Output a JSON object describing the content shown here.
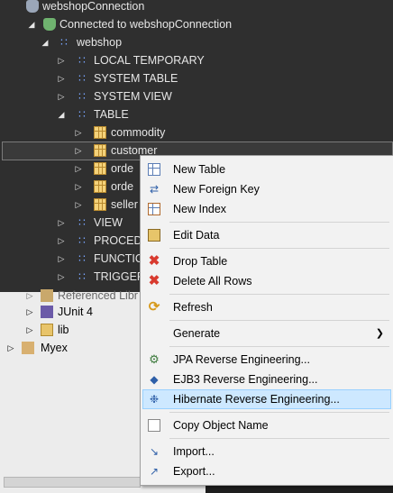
{
  "db_tree": {
    "connection_root": "webshopConnection",
    "connected_label": "Connected to webshopConnection",
    "schema": "webshop",
    "groups": {
      "local_temporary": "LOCAL TEMPORARY",
      "system_table": "SYSTEM TABLE",
      "system_view": "SYSTEM VIEW",
      "table": "TABLE",
      "view": "VIEW",
      "procedure": "PROCEDU",
      "function": "FUNCTIO",
      "trigger": "TRIGGER"
    },
    "tables": [
      "commodity",
      "customer",
      "orde",
      "orde",
      "seller"
    ]
  },
  "project_tree": {
    "referenced_libraries": "Referenced Libr",
    "junit": "JUnit 4",
    "lib": "lib",
    "project": "Myex"
  },
  "context_menu": {
    "new_table": "New Table",
    "new_foreign_key": "New Foreign Key",
    "new_index": "New Index",
    "edit_data": "Edit Data",
    "drop_table": "Drop Table",
    "delete_all_rows": "Delete All Rows",
    "refresh": "Refresh",
    "generate": "Generate",
    "jpa_reverse": "JPA Reverse Engineering...",
    "ejb3_reverse": "EJB3 Reverse Engineering...",
    "hibernate_reverse": "Hibernate Reverse Engineering...",
    "copy_object_name": "Copy Object Name",
    "import": "Import...",
    "export": "Export..."
  },
  "colors": {
    "db_panel_bg": "#2f2f2f",
    "project_panel_bg": "#ececec",
    "menu_bg": "#f2f2f2",
    "highlight": "#cde8ff"
  }
}
